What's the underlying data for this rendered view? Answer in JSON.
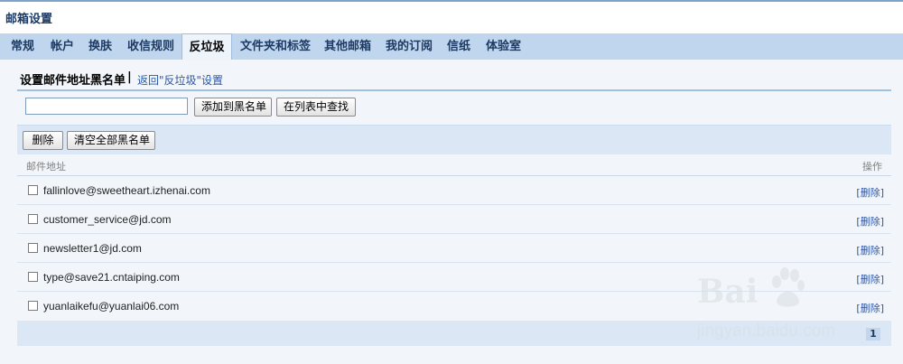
{
  "page": {
    "title": "邮箱设置"
  },
  "tabs": [
    {
      "label": "常规"
    },
    {
      "label": "帐户"
    },
    {
      "label": "换肤"
    },
    {
      "label": "收信规则"
    },
    {
      "label": "反垃圾",
      "active": true
    },
    {
      "label": "文件夹和标签"
    },
    {
      "label": "其他邮箱"
    },
    {
      "label": "我的订阅"
    },
    {
      "label": "信纸"
    },
    {
      "label": "体验室"
    }
  ],
  "section": {
    "heading": "设置邮件地址黑名单",
    "separator": "|",
    "back_link": "返回\"反垃圾\"设置"
  },
  "form": {
    "input_value": "",
    "add_button": "添加到黑名单",
    "find_button": "在列表中查找"
  },
  "toolbar": {
    "delete_button": "删除",
    "clear_all_button": "清空全部黑名单"
  },
  "list": {
    "header_email": "邮件地址",
    "header_action": "操作",
    "rows": [
      {
        "email": "fallinlove@sweetheart.izhenai.com",
        "action": "[删除]"
      },
      {
        "email": "customer_service@jd.com",
        "action": "[删除]"
      },
      {
        "email": "newsletter1@jd.com",
        "action": "[删除]"
      },
      {
        "email": "type@save21.cntaiping.com",
        "action": "[删除]"
      },
      {
        "email": "yuanlaikefu@yuanlai06.com",
        "action": "[删除]"
      }
    ]
  },
  "pager": {
    "current_page": "1"
  },
  "watermark": {
    "logo_text": "Bai",
    "logo_icon": "paw-icon",
    "url": "jingyan.baidu.com"
  },
  "colors": {
    "accent": "#1d3a63",
    "tab_bar": "#c0d6ee",
    "link": "#2a56a6",
    "panel": "#f2f6fb"
  }
}
